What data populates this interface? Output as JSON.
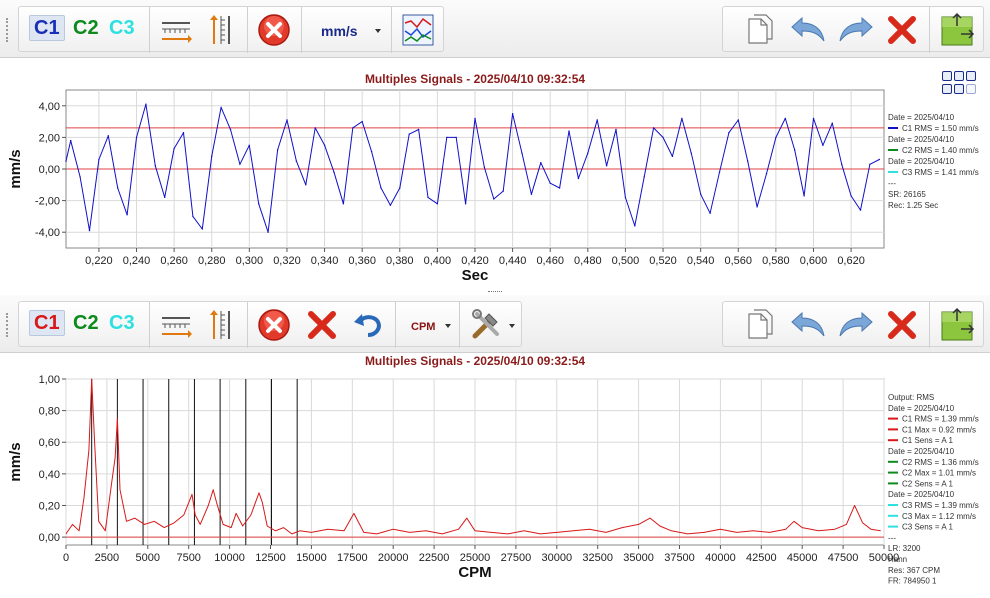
{
  "toolbar_top": {
    "channels": [
      {
        "label": "C1",
        "color": "#1a2fb8",
        "selected": true
      },
      {
        "label": "C2",
        "color": "#0c8a1c",
        "selected": false
      },
      {
        "label": "C3",
        "color": "#2ee0e0",
        "selected": false
      }
    ],
    "unit": "mm/s",
    "icons": [
      "x-scale-icon",
      "y-scale-icon",
      "close-circle-icon",
      "unit-dropdown",
      "multi-signal-icon"
    ],
    "right_icons": [
      "copy-icon",
      "undo-icon",
      "redo-icon",
      "delete-icon",
      "export-icon"
    ]
  },
  "toolbar_bottom": {
    "channels": [
      {
        "label": "C1",
        "color": "#d81818",
        "selected": true
      },
      {
        "label": "C2",
        "color": "#0c8a1c",
        "selected": false
      },
      {
        "label": "C3",
        "color": "#2ee0e0",
        "selected": false
      }
    ],
    "unit": "CPM",
    "icons": [
      "x-scale-icon",
      "y-scale-icon",
      "close-circle-icon",
      "delete-x-icon",
      "undo-arrow-icon",
      "unit-dropdown",
      "tools-icon"
    ],
    "right_icons": [
      "copy-icon",
      "undo-icon",
      "redo-icon",
      "delete-icon",
      "export-icon"
    ]
  },
  "chart_data": [
    {
      "type": "line",
      "title": "Multiples Signals - 2025/04/10 09:32:54",
      "xlabel": "Sec",
      "ylabel": "mm/s",
      "xlim": [
        0.2025,
        0.6375
      ],
      "ylim": [
        -5,
        5
      ],
      "x_ticks": [
        "0,220",
        "0,240",
        "0,260",
        "0,280",
        "0,300",
        "0,320",
        "0,340",
        "0,360",
        "0,380",
        "0,400",
        "0,420",
        "0,440",
        "0,460",
        "0,480",
        "0,500",
        "0,520",
        "0,540",
        "0,560",
        "0,580",
        "0,600",
        "0,620"
      ],
      "x_tick_values": [
        0.22,
        0.24,
        0.26,
        0.28,
        0.3,
        0.32,
        0.34,
        0.36,
        0.38,
        0.4,
        0.42,
        0.44,
        0.46,
        0.48,
        0.5,
        0.52,
        0.54,
        0.56,
        0.58,
        0.6,
        0.62
      ],
      "y_ticks": [
        "4,00",
        "2,00",
        "0,00",
        "-2,00",
        "-4,00"
      ],
      "y_tick_values": [
        4,
        2,
        0,
        -2,
        -4
      ],
      "reference_lines": [
        0,
        2.6
      ],
      "grid": true,
      "series": [
        {
          "name": "C1",
          "color": "#1010c8",
          "x": [
            0.2025,
            0.205,
            0.21,
            0.215,
            0.22,
            0.225,
            0.23,
            0.235,
            0.24,
            0.245,
            0.25,
            0.255,
            0.26,
            0.265,
            0.27,
            0.275,
            0.28,
            0.285,
            0.29,
            0.295,
            0.3,
            0.305,
            0.31,
            0.315,
            0.32,
            0.325,
            0.33,
            0.335,
            0.34,
            0.345,
            0.35,
            0.355,
            0.36,
            0.365,
            0.37,
            0.375,
            0.38,
            0.385,
            0.39,
            0.395,
            0.4,
            0.405,
            0.41,
            0.415,
            0.42,
            0.425,
            0.43,
            0.435,
            0.44,
            0.445,
            0.45,
            0.455,
            0.46,
            0.465,
            0.47,
            0.475,
            0.48,
            0.485,
            0.49,
            0.495,
            0.5,
            0.505,
            0.51,
            0.515,
            0.52,
            0.525,
            0.53,
            0.535,
            0.54,
            0.545,
            0.55,
            0.555,
            0.56,
            0.565,
            0.57,
            0.575,
            0.58,
            0.585,
            0.59,
            0.595,
            0.6,
            0.605,
            0.61,
            0.615,
            0.62,
            0.625,
            0.63,
            0.635
          ],
          "y": [
            0.5,
            1.8,
            -0.5,
            -3.9,
            0.6,
            2.1,
            -1.2,
            -2.9,
            2.0,
            4.1,
            0.2,
            -1.8,
            1.3,
            2.3,
            -3.0,
            -3.8,
            0.8,
            3.9,
            2.5,
            0.3,
            1.5,
            -2.2,
            -4.0,
            1.2,
            3.1,
            0.5,
            -1.0,
            2.6,
            1.5,
            -0.2,
            -2.2,
            2.6,
            3.0,
            1.1,
            -1.2,
            -2.3,
            -1.2,
            2.2,
            2.5,
            -1.8,
            -2.2,
            2.0,
            2.0,
            -2.2,
            3.2,
            0.1,
            -1.9,
            -1.4,
            3.5,
            1.0,
            -1.6,
            0.4,
            -0.9,
            -1.2,
            2.4,
            -0.6,
            1.0,
            3.1,
            0.2,
            2.5,
            -1.8,
            -3.6,
            -0.5,
            2.6,
            2.0,
            0.8,
            3.2,
            1.0,
            -1.6,
            -2.8,
            -0.2,
            2.3,
            3.1,
            0.5,
            -2.4,
            -0.3,
            2.0,
            3.2,
            1.2,
            -1.7,
            3.2,
            1.5,
            2.9,
            0.3,
            -1.7,
            -2.6,
            0.3,
            0.6
          ]
        },
        {
          "name": "C2",
          "color": "#0c8a1c",
          "x": [],
          "y": []
        },
        {
          "name": "C3",
          "color": "#2ee0e0",
          "x": [],
          "y": []
        }
      ],
      "legend_position": "right",
      "legend": [
        {
          "text": "Date = 2025/04/10",
          "color": null
        },
        {
          "text": "C1 RMS = 1.50 mm/s",
          "color": "#1010c8"
        },
        {
          "text": "Date = 2025/04/10",
          "color": null
        },
        {
          "text": "C2 RMS = 1.40 mm/s",
          "color": "#0c8a1c"
        },
        {
          "text": "Date = 2025/04/10",
          "color": null
        },
        {
          "text": "C3 RMS = 1.41 mm/s",
          "color": "#2ee0e0"
        },
        {
          "text": "---",
          "color": null
        },
        {
          "text": "SR: 26165",
          "color": null
        },
        {
          "text": "Rec: 1.25 Sec",
          "color": null
        }
      ]
    },
    {
      "type": "line",
      "title": "Multiples Signals - 2025/04/10 09:32:54",
      "xlabel": "CPM",
      "ylabel": "mm/s",
      "xlim": [
        0,
        50000
      ],
      "ylim": [
        -0.05,
        1.0
      ],
      "x_ticks": [
        "0",
        "2500",
        "5000",
        "7500",
        "10000",
        "12500",
        "15000",
        "17500",
        "20000",
        "22500",
        "25000",
        "27500",
        "30000",
        "32500",
        "35000",
        "37500",
        "40000",
        "42500",
        "45000",
        "47500",
        "50000"
      ],
      "x_tick_values": [
        0,
        2500,
        5000,
        7500,
        10000,
        12500,
        15000,
        17500,
        20000,
        22500,
        25000,
        27500,
        30000,
        32500,
        35000,
        37500,
        40000,
        42500,
        45000,
        47500,
        50000
      ],
      "y_ticks": [
        "1,00",
        "0,80",
        "0,60",
        "0,40",
        "0,20",
        "0,00"
      ],
      "y_tick_values": [
        1.0,
        0.8,
        0.6,
        0.4,
        0.2,
        0.0
      ],
      "reference_lines": [
        0.0
      ],
      "harmonic_markers": [
        1570,
        3140,
        4710,
        6280,
        7850,
        9420,
        10990,
        12560,
        14130
      ],
      "grid": true,
      "series": [
        {
          "name": "C1",
          "color": "#d81818",
          "x": [
            0,
            400,
            800,
            1100,
            1400,
            1570,
            1750,
            2000,
            2400,
            2800,
            3000,
            3140,
            3300,
            3700,
            4200,
            4800,
            5400,
            6000,
            6600,
            7200,
            7700,
            7900,
            8200,
            8700,
            9000,
            9200,
            9600,
            10100,
            10400,
            10800,
            11300,
            11800,
            12000,
            12300,
            12800,
            13300,
            13800,
            14300,
            15000,
            16000,
            17000,
            17600,
            18200,
            19000,
            20000,
            21000,
            22000,
            23000,
            24000,
            24500,
            25000,
            26000,
            27000,
            28000,
            29000,
            30000,
            31000,
            32000,
            33000,
            34000,
            35000,
            35700,
            36300,
            37000,
            38000,
            39000,
            40000,
            41000,
            42000,
            43000,
            44000,
            44500,
            45000,
            46000,
            47000,
            47700,
            48200,
            48700,
            49200,
            49800
          ],
          "y": [
            0.02,
            0.08,
            0.04,
            0.25,
            0.55,
            1.0,
            0.6,
            0.1,
            0.04,
            0.35,
            0.5,
            0.75,
            0.3,
            0.1,
            0.12,
            0.08,
            0.1,
            0.06,
            0.09,
            0.14,
            0.27,
            0.14,
            0.08,
            0.2,
            0.3,
            0.22,
            0.08,
            0.06,
            0.15,
            0.07,
            0.14,
            0.28,
            0.22,
            0.07,
            0.04,
            0.06,
            0.02,
            0.04,
            0.03,
            0.05,
            0.04,
            0.15,
            0.03,
            0.02,
            0.05,
            0.03,
            0.04,
            0.02,
            0.05,
            0.12,
            0.04,
            0.03,
            0.02,
            0.04,
            0.02,
            0.03,
            0.04,
            0.05,
            0.03,
            0.06,
            0.08,
            0.12,
            0.07,
            0.04,
            0.02,
            0.03,
            0.05,
            0.03,
            0.04,
            0.03,
            0.05,
            0.1,
            0.06,
            0.04,
            0.05,
            0.08,
            0.2,
            0.09,
            0.05,
            0.04
          ]
        },
        {
          "name": "C2",
          "color": "#0c8a1c",
          "x": [],
          "y": []
        },
        {
          "name": "C3",
          "color": "#2ee0e0",
          "x": [],
          "y": []
        }
      ],
      "legend_position": "right",
      "legend": [
        {
          "text": "Output: RMS",
          "color": null
        },
        {
          "text": "Date = 2025/04/10",
          "color": null
        },
        {
          "text": "C1 RMS = 1.39 mm/s",
          "color": "#d81818"
        },
        {
          "text": "C1 Max = 0.92 mm/s",
          "color": "#d81818"
        },
        {
          "text": "C1 Sens = A 1",
          "color": "#d81818"
        },
        {
          "text": "Date = 2025/04/10",
          "color": null
        },
        {
          "text": "C2 RMS = 1.36 mm/s",
          "color": "#0c8a1c"
        },
        {
          "text": "C2 Max = 1.01 mm/s",
          "color": "#0c8a1c"
        },
        {
          "text": "C2 Sens = A 1",
          "color": "#0c8a1c"
        },
        {
          "text": "Date = 2025/04/10",
          "color": null
        },
        {
          "text": "C3 RMS = 1.39 mm/s",
          "color": "#2ee0e0"
        },
        {
          "text": "C3 Max = 1.12 mm/s",
          "color": "#2ee0e0"
        },
        {
          "text": "C3 Sens = A 1",
          "color": "#2ee0e0"
        },
        {
          "text": "---",
          "color": null
        },
        {
          "text": "LR: 3200",
          "color": null
        },
        {
          "text": "Hann",
          "color": null
        },
        {
          "text": "Res: 367 CPM",
          "color": null
        },
        {
          "text": "FR: 784950 1",
          "color": null
        }
      ]
    }
  ]
}
